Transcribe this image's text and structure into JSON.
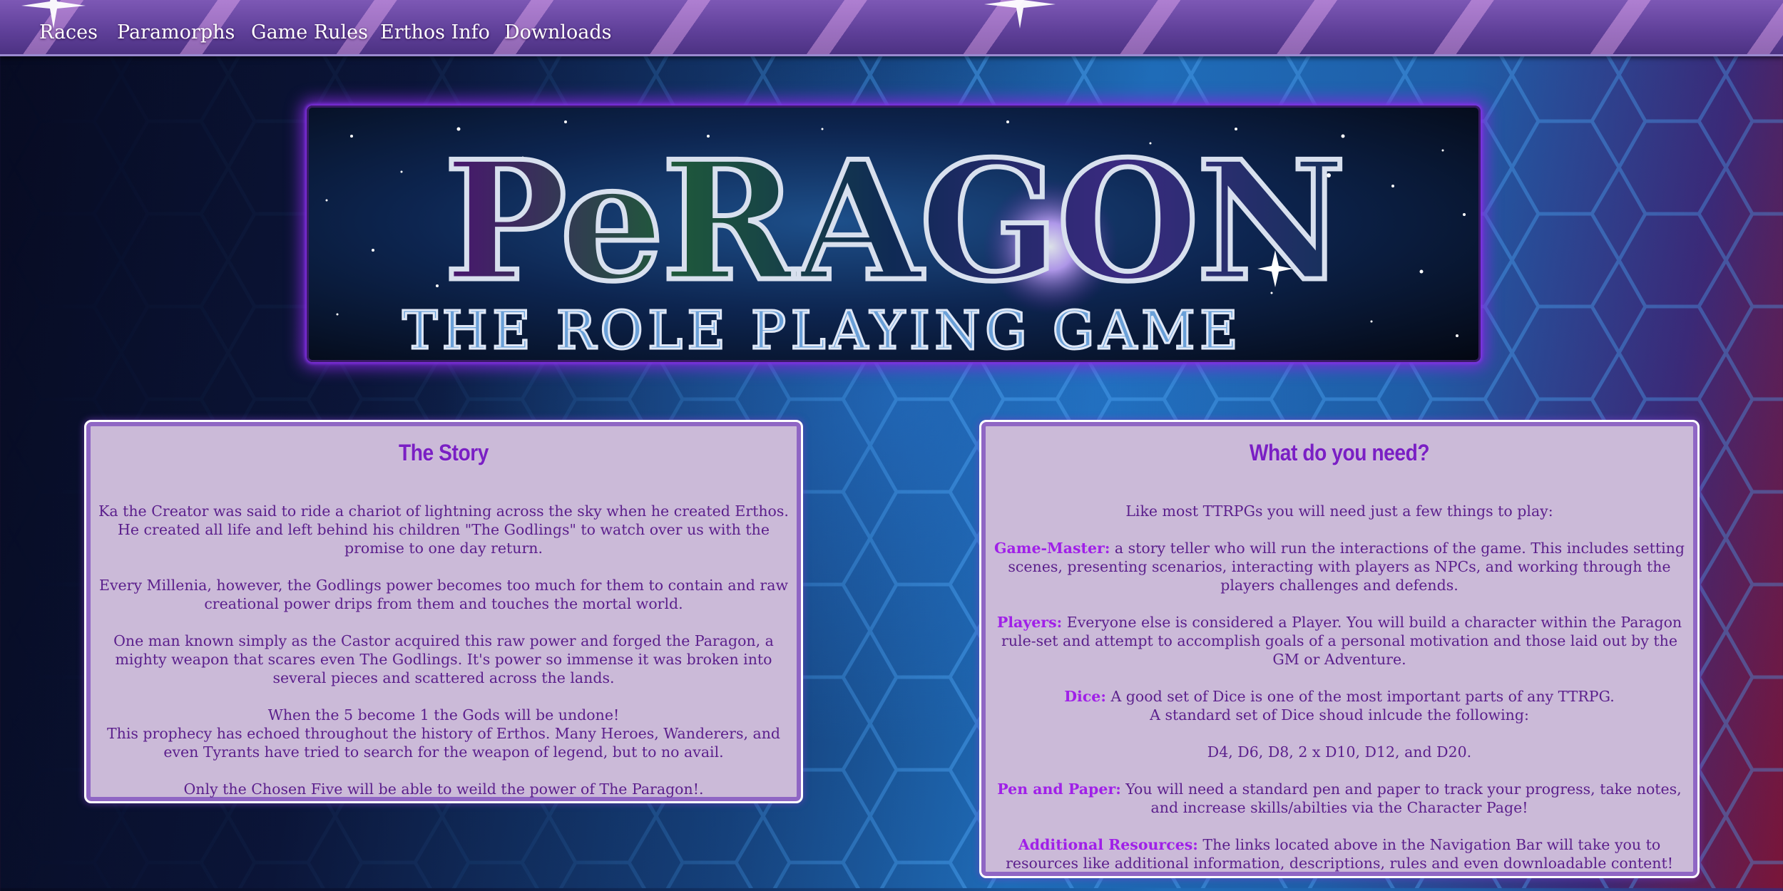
{
  "nav": {
    "items": [
      {
        "label": "Races"
      },
      {
        "label": "Paramorphs"
      },
      {
        "label": "Game Rules"
      },
      {
        "label": "Erthos Info"
      },
      {
        "label": "Downloads"
      }
    ]
  },
  "banner": {
    "title": "PeRAGON",
    "subtitle": "THE ROLE PLAYING GAME"
  },
  "story": {
    "heading": "The Story",
    "p1": "Ka the Creator was said to ride a chariot of lightning across the sky when he created Erthos. He created all life and left behind his children \"The Godlings\" to watch over us with the promise to one day return.",
    "p2": "Every Millenia, however, the Godlings power becomes too much for them to contain and raw creational power drips from them and touches the mortal world.",
    "p3": "One man known simply as the Castor acquired this raw power and forged the Paragon, a mighty weapon that scares even The Godlings. It's power so immense it was broken into several pieces and scattered across the lands.",
    "p4a": "When the 5 become 1 the Gods will be undone!",
    "p4b": "This prophecy has echoed throughout the history of Erthos. Many Heroes, Wanderers, and even Tyrants have tried to search for the weapon of legend, but to no avail.",
    "p5": "Only the Chosen Five will be able to weild the power of The Paragon!."
  },
  "needs": {
    "heading": "What do you need?",
    "intro": "Like most TTRPGs you will need just a few things to play:",
    "gm_label": "Game-Master:",
    "gm_text": " a story teller who will run the interactions of the game. This includes setting scenes, presenting scenarios, interacting with players as NPCs, and working through the players challenges and defends.",
    "players_label": "Players:",
    "players_text": " Everyone else is considered a Player. You will build a character within the Paragon rule-set and attempt to accomplish goals of a personal motivation and those laid out by the GM or Adventure.",
    "dice_label": "Dice:",
    "dice_text": " A good set of Dice is one of the most important parts of any TTRPG.",
    "dice_text2": "A standard set of Dice shoud inlcude the following:",
    "dice_list": "D4, D6, D8, 2 x D10, D12, and D20.",
    "pen_label": "Pen and Paper:",
    "pen_text": " You will need a standard pen and paper to track your progress, take notes, and increase skills/abilties via the Character Page!",
    "res_label": "Additional Resources:",
    "res_text": " The links located above in the Navigation Bar will take you to resources like additional information, descriptions, rules and even downloadable content!"
  },
  "colors": {
    "panel_bg": "#cbbad8",
    "panel_text": "#5b1f8c",
    "heading": "#7a1fc4",
    "highlight": "#a020e8",
    "nav_bg": "#5e3f98"
  }
}
